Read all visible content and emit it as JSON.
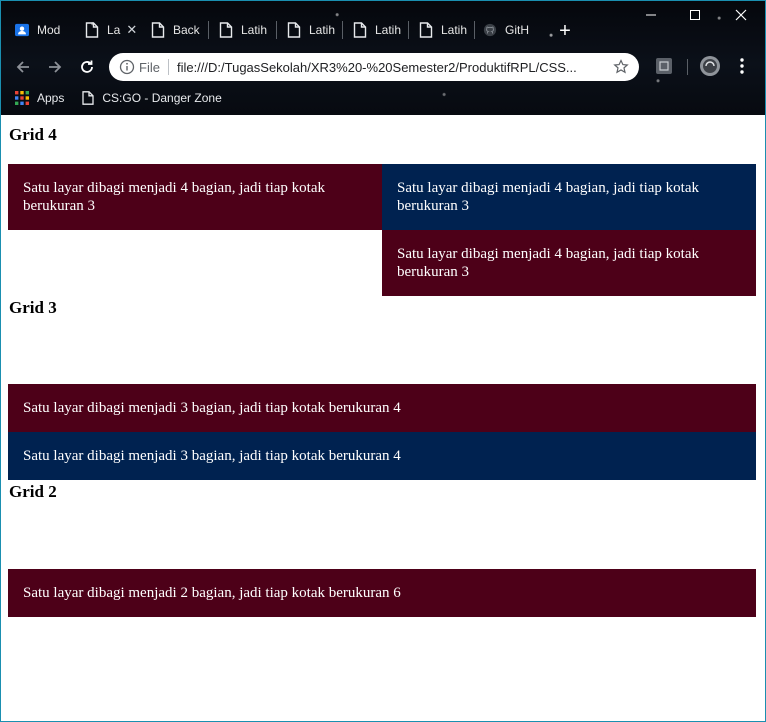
{
  "browser": {
    "tabs": [
      {
        "label": "Mod",
        "icon": "profile-icon"
      },
      {
        "label": "La",
        "icon": "page-icon",
        "active": true
      },
      {
        "label": "Back",
        "icon": "page-icon"
      },
      {
        "label": "Latih",
        "icon": "page-icon"
      },
      {
        "label": "Latih",
        "icon": "page-icon"
      },
      {
        "label": "Latih",
        "icon": "page-icon"
      },
      {
        "label": "Latih",
        "icon": "page-icon"
      },
      {
        "label": "GitH",
        "icon": "github-icon"
      }
    ],
    "new_tab_label": "+",
    "address": {
      "scheme_label": "File",
      "url": "file:///D:/TugasSekolah/XR3%20-%20Semester2/ProduktifRPL/CSS..."
    },
    "bookmarks": [
      {
        "label": "Apps",
        "icon": "apps-grid-icon"
      },
      {
        "label": "CS:GO - Danger Zone",
        "icon": "page-icon"
      }
    ]
  },
  "page": {
    "sections": [
      {
        "title": "Grid 4",
        "boxes": [
          {
            "text": "Satu layar dibagi menjadi 4 bagian, jadi tiap kotak berukuran 3",
            "color": "#4d0018"
          },
          {
            "text": "Satu layar dibagi menjadi 4 bagian, jadi tiap kotak berukuran 3",
            "color": "#002250"
          },
          {
            "text": "Satu layar dibagi menjadi 4 bagian, jadi tiap kotak berukuran 3",
            "color": "#4d0018"
          }
        ]
      },
      {
        "title": "Grid 3",
        "boxes": [
          {
            "text": "Satu layar dibagi menjadi 3 bagian, jadi tiap kotak berukuran 4",
            "color": "#4d0018"
          },
          {
            "text": "Satu layar dibagi menjadi 3 bagian, jadi tiap kotak berukuran 4",
            "color": "#002250"
          }
        ]
      },
      {
        "title": "Grid 2",
        "boxes": [
          {
            "text": "Satu layar dibagi menjadi 2 bagian, jadi tiap kotak berukuran 6",
            "color": "#4d0018"
          }
        ]
      }
    ]
  }
}
